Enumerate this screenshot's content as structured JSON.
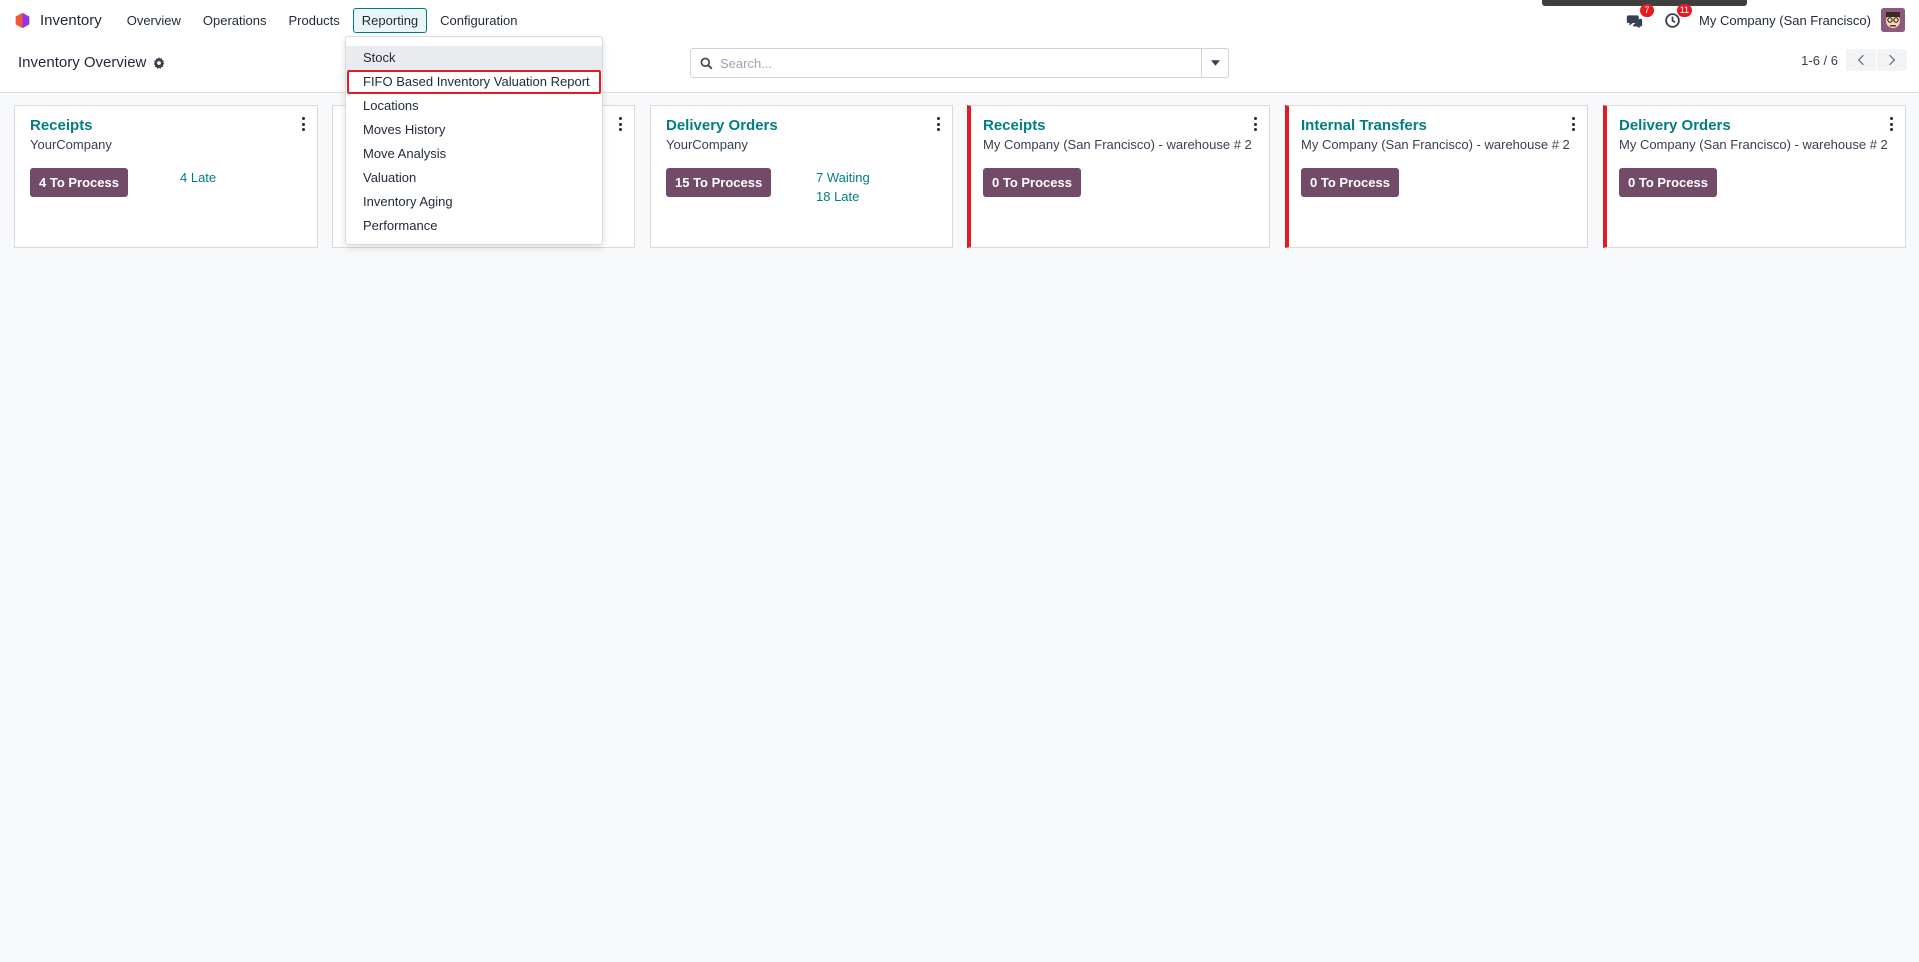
{
  "navbar": {
    "app_name": "Inventory",
    "menu": [
      {
        "label": "Overview"
      },
      {
        "label": "Operations"
      },
      {
        "label": "Products"
      },
      {
        "label": "Reporting"
      },
      {
        "label": "Configuration"
      }
    ],
    "messages_badge": "7",
    "activities_badge": "11",
    "company": "My Company (San Francisco)"
  },
  "control_panel": {
    "title": "Inventory Overview",
    "search_placeholder": "Search...",
    "pager": "1-6 / 6"
  },
  "reporting_menu": {
    "items": [
      {
        "label": "Stock"
      },
      {
        "label": "FIFO Based Inventory Valuation Report"
      },
      {
        "label": "Locations"
      },
      {
        "label": "Moves History"
      },
      {
        "label": "Move Analysis"
      },
      {
        "label": "Valuation"
      },
      {
        "label": "Inventory Aging"
      },
      {
        "label": "Performance"
      }
    ]
  },
  "cards": [
    {
      "title": "Receipts",
      "subtitle": "YourCompany",
      "button": "4 To Process",
      "stats": [
        "4 Late"
      ]
    },
    {
      "title": "",
      "subtitle": "",
      "button": "",
      "stats": []
    },
    {
      "title": "Delivery Orders",
      "subtitle": "YourCompany",
      "button": "15 To Process",
      "stats": [
        "7 Waiting",
        "18 Late"
      ]
    },
    {
      "title": "Receipts",
      "subtitle": "My Company (San Francisco) - warehouse # 2",
      "button": "0 To Process",
      "stats": []
    },
    {
      "title": "Internal Transfers",
      "subtitle": "My Company (San Francisco) - warehouse # 2",
      "button": "0 To Process",
      "stats": []
    },
    {
      "title": "Delivery Orders",
      "subtitle": "My Company (San Francisco) - warehouse # 2",
      "button": "0 To Process",
      "stats": []
    }
  ],
  "colors": {
    "brand": "#714b67",
    "link": "#017e84",
    "alert": "#e31b23"
  }
}
